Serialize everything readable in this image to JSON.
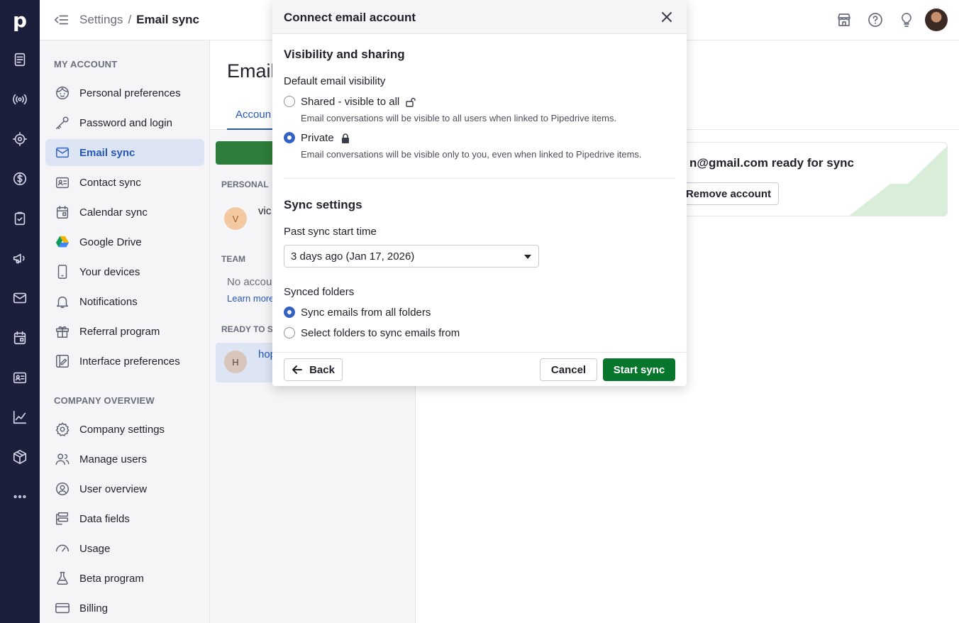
{
  "rail": {
    "logo": "p",
    "icons": [
      "deals-icon",
      "leads-icon",
      "focus-icon",
      "money-icon",
      "tasks-icon",
      "campaigns-icon",
      "mail-icon",
      "calendar-icon",
      "contacts-icon",
      "insights-icon",
      "products-icon",
      "more-icon"
    ]
  },
  "topbar": {
    "breadcrumb_parent": "Settings",
    "breadcrumb_sep": "/",
    "breadcrumb_current": "Email sync"
  },
  "sidebar": {
    "my_account_header": "MY ACCOUNT",
    "my_account_items": [
      {
        "label": "Personal preferences",
        "icon": "face-icon"
      },
      {
        "label": "Password and login",
        "icon": "key-icon"
      },
      {
        "label": "Email sync",
        "icon": "mail-icon",
        "active": true
      },
      {
        "label": "Contact sync",
        "icon": "contact-card-icon"
      },
      {
        "label": "Calendar sync",
        "icon": "calendar-icon"
      },
      {
        "label": "Google Drive",
        "icon": "google-drive-icon"
      },
      {
        "label": "Your devices",
        "icon": "phone-icon"
      },
      {
        "label": "Notifications",
        "icon": "bell-icon"
      },
      {
        "label": "Referral program",
        "icon": "gift-icon"
      },
      {
        "label": "Interface preferences",
        "icon": "interface-icon"
      }
    ],
    "company_header": "COMPANY OVERVIEW",
    "company_items": [
      {
        "label": "Company settings",
        "icon": "gear-icon"
      },
      {
        "label": "Manage users",
        "icon": "users-icon"
      },
      {
        "label": "User overview",
        "icon": "user-circle-icon"
      },
      {
        "label": "Data fields",
        "icon": "data-fields-icon"
      },
      {
        "label": "Usage",
        "icon": "gauge-icon"
      },
      {
        "label": "Beta program",
        "icon": "flask-icon"
      },
      {
        "label": "Billing",
        "icon": "card-icon"
      }
    ]
  },
  "main": {
    "page_title": "Email",
    "tab_label": "Accoun",
    "personal_label": "PERSONAL",
    "personal_account": {
      "initial": "V",
      "name": "vic"
    },
    "team_label": "TEAM",
    "team_empty": "No accou",
    "team_link": "Learn more",
    "ready_label": "READY TO SY",
    "ready_account": {
      "initial": "H",
      "name": "hop"
    },
    "card_title": "n@gmail.com ready for sync",
    "remove_button": "Remove account"
  },
  "modal": {
    "title": "Connect email account",
    "visibility_title": "Visibility and sharing",
    "visibility_label": "Default email visibility",
    "option_shared": "Shared - visible to all",
    "option_shared_desc": "Email conversations will be visible to all users when linked to Pipedrive items.",
    "option_private": "Private",
    "option_private_desc": "Email conversations will be visible only to you, even when linked to Pipedrive items.",
    "visibility_selected": "Private",
    "sync_title": "Sync settings",
    "past_sync_label": "Past sync start time",
    "past_sync_value": "3 days ago (Jan 17, 2026)",
    "folders_label": "Synced folders",
    "folder_all": "Sync emails from all folders",
    "folder_select": "Select folders to sync emails from",
    "folders_selected": "Sync emails from all folders",
    "back_button": "Back",
    "cancel_button": "Cancel",
    "start_button": "Start sync"
  },
  "colors": {
    "rail": "#1c1f3b",
    "primary_green": "#08752d",
    "accent_blue": "#3162c4"
  }
}
